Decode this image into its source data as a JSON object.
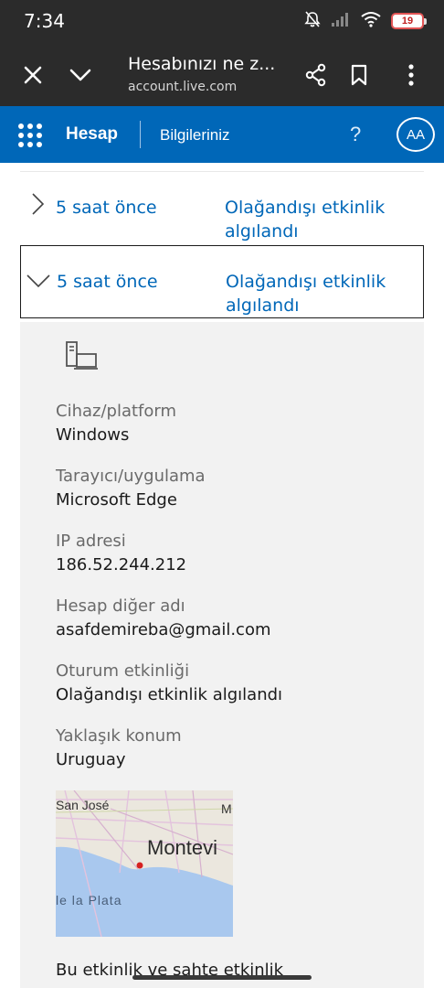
{
  "status_bar": {
    "time": "7:34",
    "battery": "19",
    "icons": [
      "mute-icon",
      "signal-icon",
      "wifi-icon",
      "battery-icon"
    ]
  },
  "browser": {
    "page_title": "Hesabınızı ne z...",
    "url": "account.live.com",
    "icons": [
      "close-icon",
      "chevron-down-icon",
      "share-icon",
      "bookmark-icon",
      "more-icon"
    ]
  },
  "header": {
    "brand": "Hesap",
    "nav_item": "Bilgileriniz",
    "glyph": "",
    "help": "?",
    "avatar_initials": "AA",
    "accent_color": "#0067b8"
  },
  "activity_rows": [
    {
      "time": "5 saat önce",
      "event": "Olağandışı etkinlik algılandı",
      "expanded": false
    },
    {
      "time": "5 saat önce",
      "event": "Olağandışı etkinlik algılandı",
      "expanded": true
    }
  ],
  "details": {
    "device_label": "Cihaz/platform",
    "device_value": "Windows",
    "browser_label": "Tarayıcı/uygulama",
    "browser_value": "Microsoft Edge",
    "ip_label": "IP adresi",
    "ip_value": "186.52.244.212",
    "alias_label": "Hesap diğer adı",
    "alias_value": "asafdemireba@gmail.com",
    "session_label": "Oturum etkinliği",
    "session_value": "Olağandışı etkinlik algılandı",
    "location_label": "Yaklaşık konum",
    "location_value": "Uruguay"
  },
  "map": {
    "labels": [
      "San José",
      "M",
      "Montevi",
      "le la Plata"
    ]
  },
  "cutoff_text": "Bu etkinlik ve sahte etkinlik"
}
